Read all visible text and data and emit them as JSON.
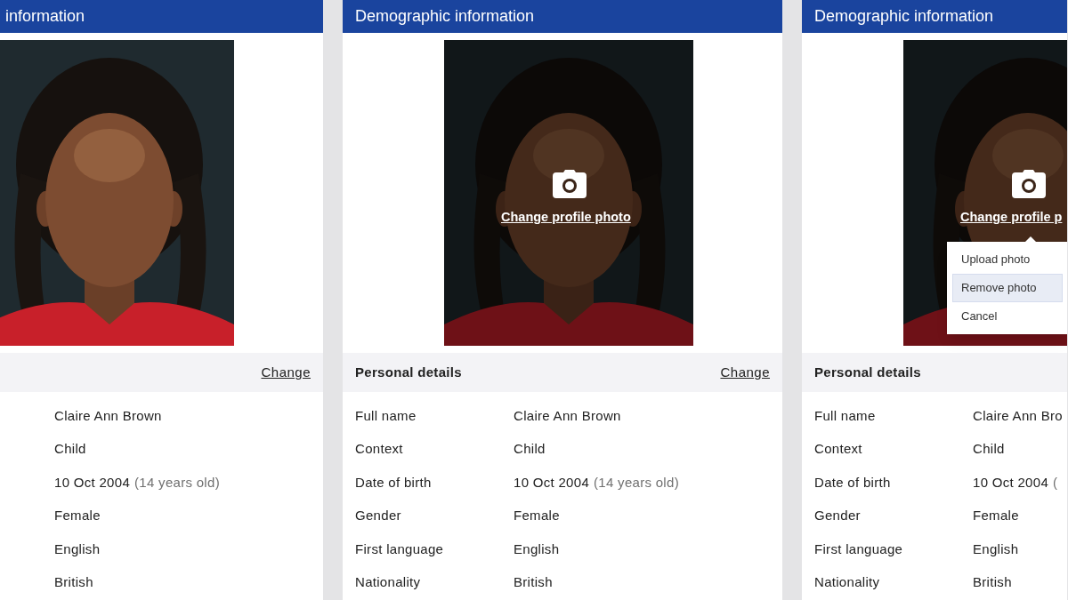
{
  "panels": [
    {
      "title": "information",
      "section": {
        "action": "Change"
      },
      "rows": [
        {
          "value": "Claire Ann Brown"
        },
        {
          "value": "Child"
        },
        {
          "value": "10 Oct 2004",
          "note": "(14 years old)"
        },
        {
          "value": "Female"
        },
        {
          "value": "English"
        },
        {
          "value": "British"
        }
      ]
    },
    {
      "title": "Demographic information",
      "photo": {
        "kind": "picture",
        "dimmed": true,
        "caption": "Change profile photo"
      },
      "section": {
        "title": "Personal details",
        "action": "Change"
      },
      "rows": [
        {
          "label": "Full name",
          "value": "Claire Ann Brown"
        },
        {
          "label": "Context",
          "value": "Child"
        },
        {
          "label": "Date of birth",
          "value": "10 Oct 2004",
          "note": "(14 years old)"
        },
        {
          "label": "Gender",
          "value": "Female"
        },
        {
          "label": "First language",
          "value": "English"
        },
        {
          "label": "Nationality",
          "value": "British"
        }
      ]
    },
    {
      "title": "Demographic information",
      "photo": {
        "kind": "picture",
        "dimmed": true,
        "caption": "Change profile p",
        "menu": [
          {
            "label": "Upload photo",
            "selected": false
          },
          {
            "label": "Remove photo",
            "selected": true
          },
          {
            "label": "Cancel",
            "selected": false
          }
        ]
      },
      "section": {
        "title": "Personal details"
      },
      "rows": [
        {
          "label": "Full name",
          "value": "Claire Ann Bro"
        },
        {
          "label": "Context",
          "value": "Child"
        },
        {
          "label": "Date of birth",
          "value": "10 Oct 2004",
          "note": "("
        },
        {
          "label": "Gender",
          "value": "Female"
        },
        {
          "label": "First language",
          "value": "English"
        },
        {
          "label": "Nationality",
          "value": "British"
        }
      ]
    }
  ]
}
